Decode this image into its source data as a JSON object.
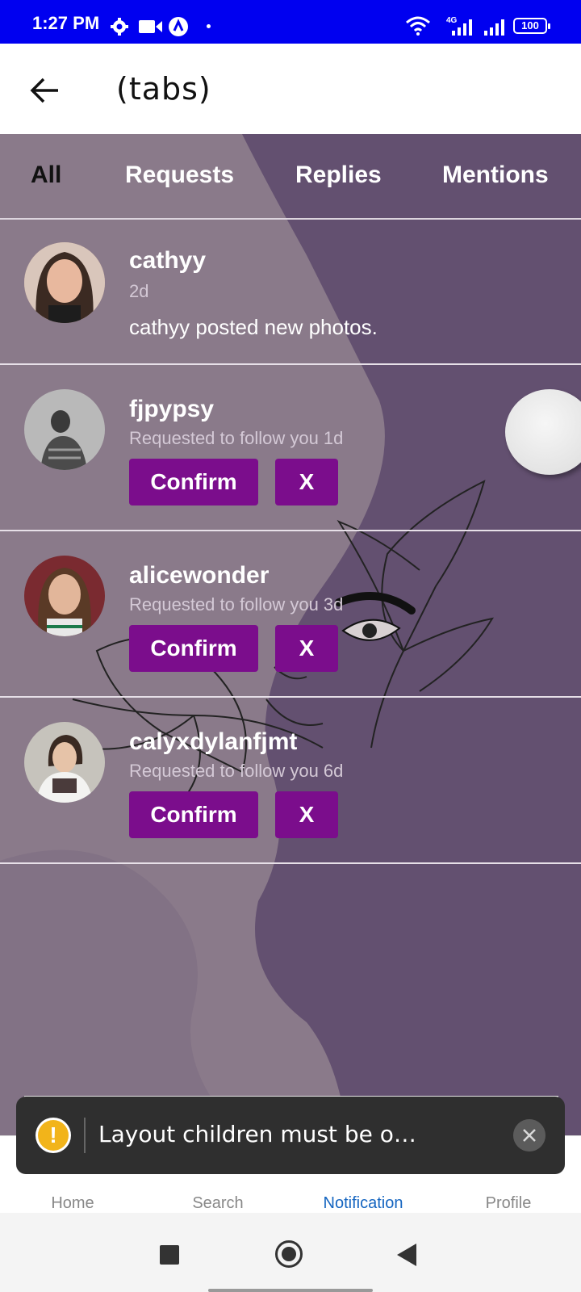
{
  "status_bar": {
    "time": "1:27 PM",
    "network_label": "4G",
    "battery": "100"
  },
  "header": {
    "title": "(tabs)",
    "back_icon": "arrow-left-icon"
  },
  "tabs": [
    {
      "label": "All",
      "active": true
    },
    {
      "label": "Requests",
      "active": false
    },
    {
      "label": "Replies",
      "active": false
    },
    {
      "label": "Mentions",
      "active": false
    }
  ],
  "notifications": [
    {
      "username": "cathyy",
      "time": "2d",
      "message": "cathyy posted new photos.",
      "type": "post"
    },
    {
      "username": "fjpypsy",
      "subtitle": "Requested to follow you 1d",
      "type": "request",
      "confirm_label": "Confirm",
      "reject_label": "X"
    },
    {
      "username": "alicewonder",
      "subtitle": "Requested to follow you 3d",
      "type": "request",
      "confirm_label": "Confirm",
      "reject_label": "X"
    },
    {
      "username": "calyxdylanfjmt",
      "subtitle": "Requested to follow you 6d",
      "type": "request",
      "confirm_label": "Confirm",
      "reject_label": "X"
    }
  ],
  "bottom_nav": [
    {
      "label": "Home",
      "icon": "home-icon",
      "active": false
    },
    {
      "label": "Search",
      "icon": "search-icon",
      "active": false
    },
    {
      "label": "Notification",
      "icon": "bell-icon",
      "active": true
    },
    {
      "label": "Profile",
      "icon": "person-icon",
      "active": false
    }
  ],
  "toast": {
    "message": "Layout children must be of type Screen…",
    "icon": "warning-icon",
    "close_icon": "close-icon"
  },
  "colors": {
    "status_bar": "#0000f0",
    "accent_button": "#7b0d8c",
    "active_nav": "#1565c0",
    "background_overlay": "#8a7a8a"
  }
}
